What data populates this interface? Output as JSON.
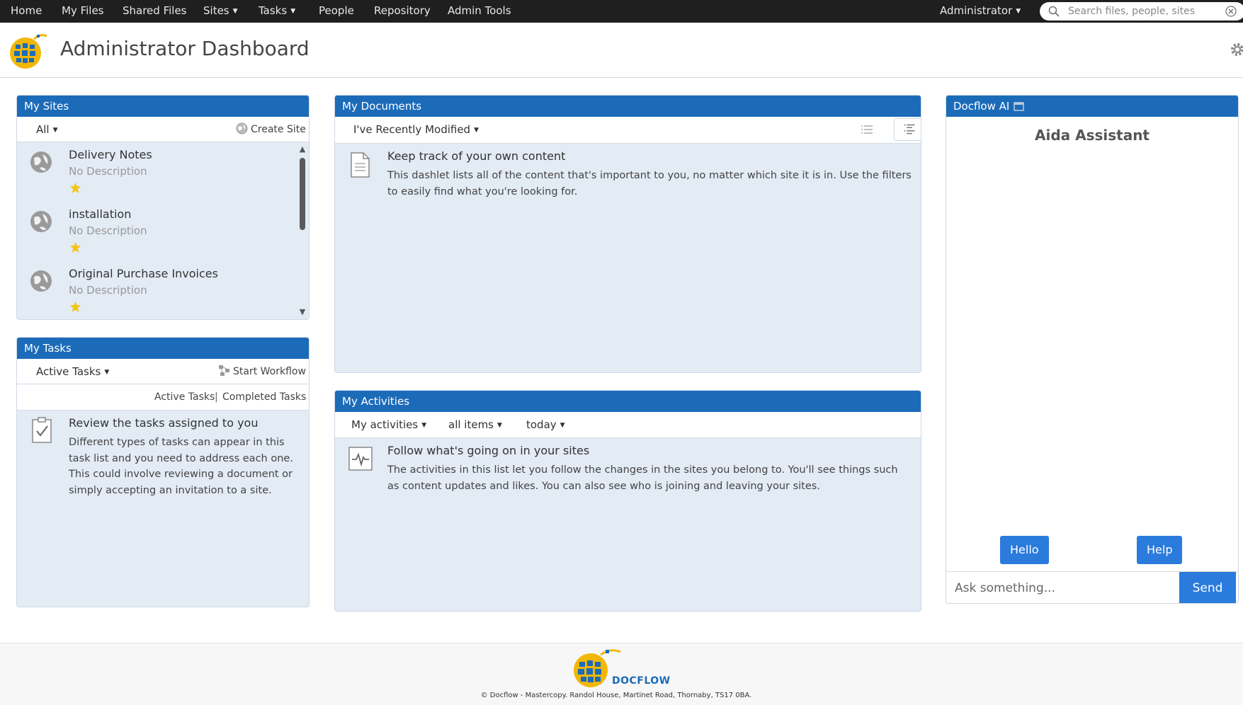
{
  "nav": {
    "items": [
      {
        "label": "Home"
      },
      {
        "label": "My Files"
      },
      {
        "label": "Shared Files"
      },
      {
        "label": "Sites",
        "dropdown": true
      },
      {
        "label": "Tasks",
        "dropdown": true
      },
      {
        "label": "People"
      },
      {
        "label": "Repository"
      },
      {
        "label": "Admin Tools"
      }
    ],
    "user_menu": "Administrator",
    "search_placeholder": "Search files, people, sites",
    "caret": "▼"
  },
  "header": {
    "title": "Administrator Dashboard"
  },
  "my_sites": {
    "title": "My Sites",
    "filter": "All",
    "create_label": "Create Site",
    "sites": [
      {
        "name": "Delivery Notes",
        "description": "No Description",
        "favorite": true
      },
      {
        "name": "installation",
        "description": "No Description",
        "favorite": true
      },
      {
        "name": "Original Purchase Invoices",
        "description": "No Description",
        "favorite": true
      }
    ]
  },
  "my_tasks": {
    "title": "My Tasks",
    "filter": "Active Tasks",
    "start_workflow_label": "Start Workflow",
    "links": {
      "active": "Active Tasks",
      "separator": "|",
      "completed": "Completed Tasks"
    },
    "empty_heading": "Review the tasks assigned to you",
    "empty_text": "Different types of tasks can appear in this task list and you need to address each one. This could involve reviewing a document or simply accepting an invitation to a site."
  },
  "my_documents": {
    "title": "My Documents",
    "filter": "I've Recently Modified",
    "empty_heading": "Keep track of your own content",
    "empty_text": "This dashlet lists all of the content that's important to you, no matter which site it is in. Use the filters to easily find what you're looking for."
  },
  "my_activities": {
    "title": "My Activities",
    "filters": [
      "My activities",
      "all items",
      "today"
    ],
    "empty_heading": "Follow what's going on in your sites",
    "empty_text": "The activities in this list let you follow the changes in the sites you belong to. You'll see things such as content updates and likes. You can also see who is joining and leaving your sites."
  },
  "docflow_ai": {
    "title": "Docflow AI",
    "heading": "Aida Assistant",
    "quick_buttons": [
      "Hello",
      "Help"
    ],
    "input_placeholder": "Ask something...",
    "send_label": "Send"
  },
  "footer": {
    "brand": "DOCFLOW",
    "copyright": "© Docflow - Mastercopy. Randol House, Martinet Road, Thornaby, TS17 0BA."
  },
  "colors": {
    "nav_bg": "#1f1f1f",
    "dashlet_title_bg": "#1c6bb8",
    "dashlet_body_bg": "#e3ebf5",
    "button_blue": "#2a7bdc",
    "star_yellow": "#f5c518",
    "logo_yellow": "#f2b705"
  },
  "icons": {
    "search": "search-icon",
    "clear": "clear-search-icon",
    "settings": "gear-icon",
    "site": "globe-icon",
    "favorite": "star-icon",
    "document": "document-icon",
    "task": "checkbox-icon",
    "activity": "activity-icon",
    "expand": "expand-window-icon"
  }
}
